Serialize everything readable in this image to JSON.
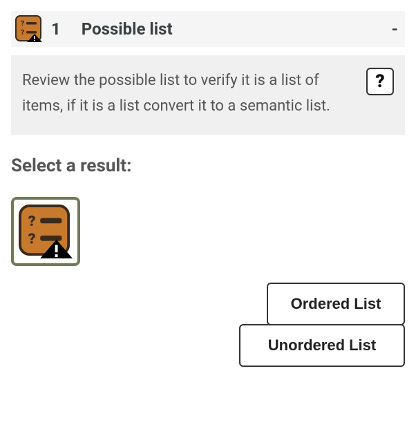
{
  "header": {
    "number": "1",
    "title": "Possible list",
    "suffix": "-"
  },
  "instruction": {
    "text": "Review the possible list to verify it is a list of items, if it is a list convert it to a semantic list.",
    "help_label": "?"
  },
  "section_heading": "Select a result:",
  "buttons": {
    "ordered": "Ordered List",
    "unordered": "Unordered List"
  },
  "icons": {
    "list_icon": "possible-list-icon"
  }
}
